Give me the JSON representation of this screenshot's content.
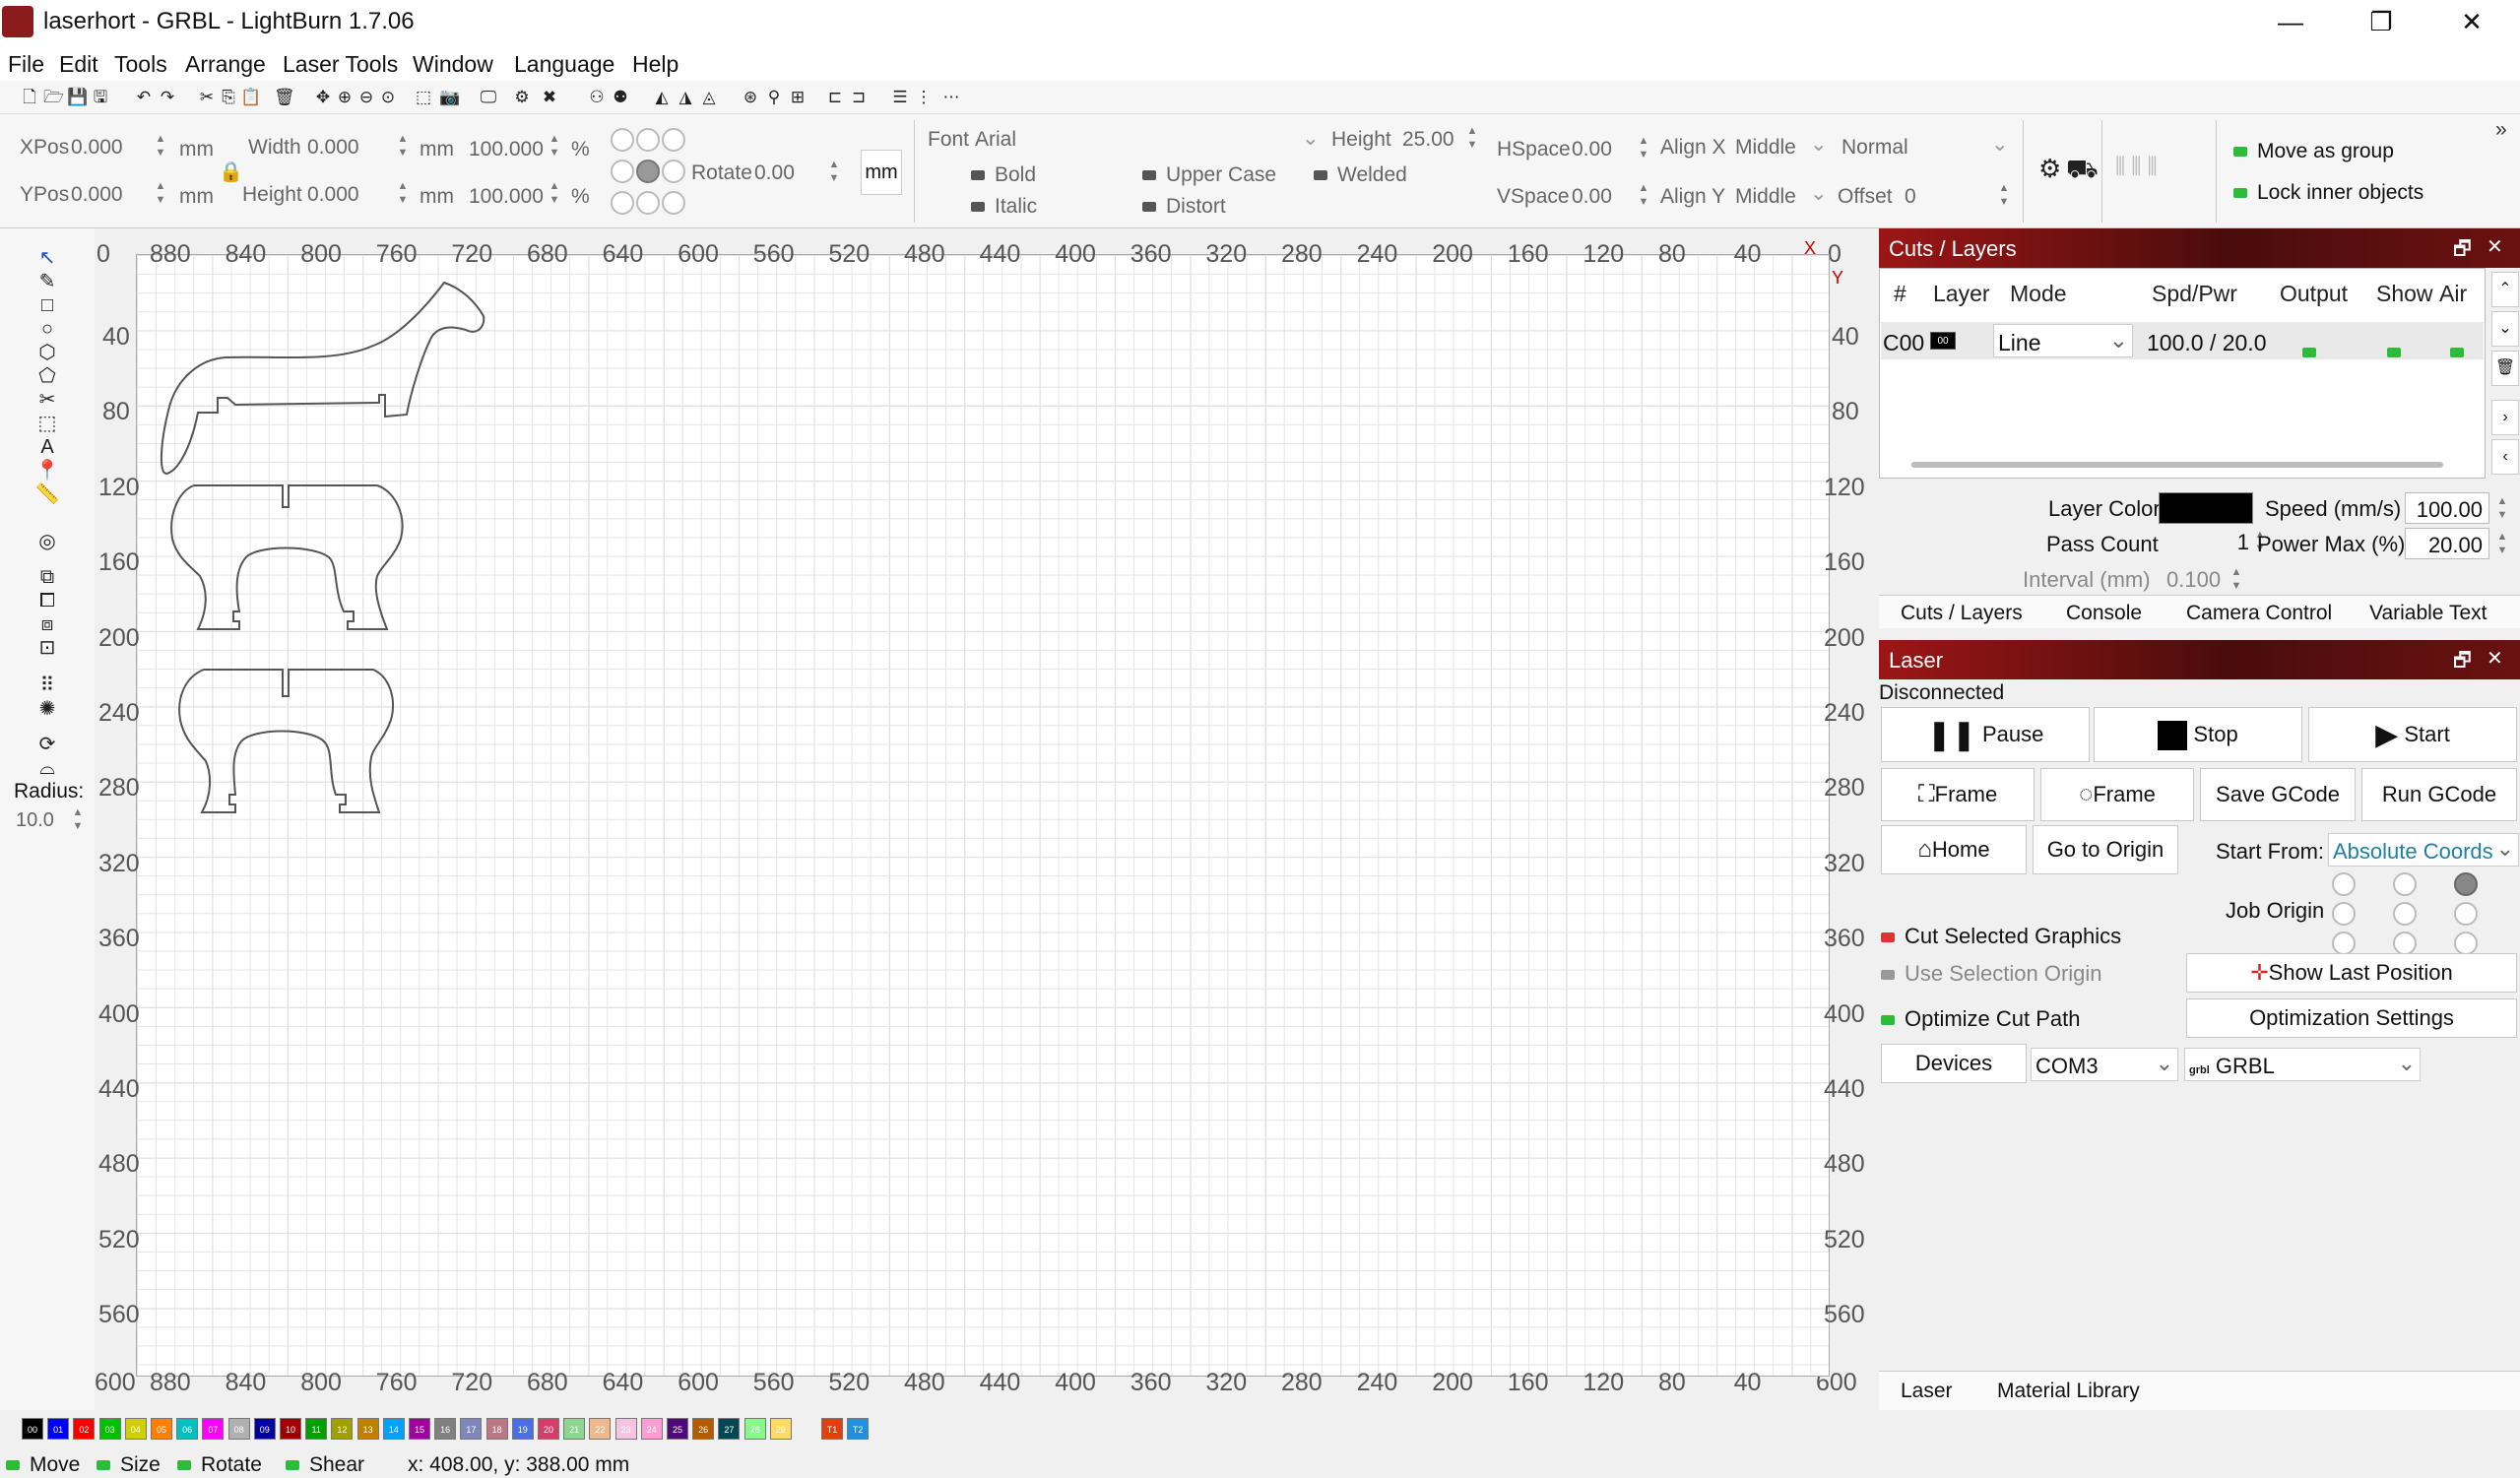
{
  "window": {
    "title": "laserhort - GRBL - LightBurn 1.7.06",
    "minimize": "—",
    "maximize": "❐",
    "close": "✕"
  },
  "menu": [
    "File",
    "Edit",
    "Tools",
    "Arrange",
    "Laser Tools",
    "Window",
    "Language",
    "Help"
  ],
  "props": {
    "xpos_label": "XPos",
    "xpos": "0.000",
    "ypos_label": "YPos",
    "ypos": "0.000",
    "unit": "mm",
    "width_label": "Width",
    "width": "0.000",
    "height_label": "Height",
    "height": "0.000",
    "scale_w": "100.000",
    "scale_h": "100.000",
    "pct": "%",
    "rotate_label": "Rotate",
    "rotate": "0.00",
    "units_btn": "mm",
    "font_label": "Font",
    "font": "Arial",
    "fheight_label": "Height",
    "fheight": "25.00",
    "hspace_label": "HSpace",
    "hspace": "0.00",
    "vspace_label": "VSpace",
    "vspace": "0.00",
    "alignx_label": "Align X",
    "alignx": "Middle",
    "aligny_label": "Align Y",
    "aligny": "Middle",
    "style": "Normal",
    "offset_label": "Offset",
    "offset": "0",
    "bold": "Bold",
    "italic": "Italic",
    "upper": "Upper Case",
    "distort": "Distort",
    "welded": "Welded",
    "move_group": "Move as group",
    "lock_inner": "Lock inner objects"
  },
  "left": {
    "radius_label": "Radius:",
    "radius": "10.0"
  },
  "ruler": {
    "top": [
      "880",
      "840",
      "800",
      "760",
      "720",
      "680",
      "640",
      "600",
      "560",
      "520",
      "480",
      "440",
      "400",
      "360",
      "320",
      "280",
      "240",
      "200",
      "160",
      "120",
      "80",
      "40"
    ],
    "side": [
      "40",
      "80",
      "120",
      "160",
      "200",
      "240",
      "280",
      "320",
      "360",
      "400",
      "440",
      "480",
      "520",
      "560"
    ],
    "corner_top_left": "0",
    "corner_top_right": "0",
    "corner_bottom": "600",
    "x": "X",
    "y": "Y"
  },
  "cuts": {
    "title": "Cuts / Layers",
    "headers": [
      "#",
      "Layer",
      "Mode",
      "Spd/Pwr",
      "Output",
      "Show",
      "Air"
    ],
    "row": {
      "num": "C00",
      "layer": "00",
      "mode": "Line",
      "spdpwr": "100.0 / 20.0"
    },
    "layer_color_label": "Layer Color",
    "layer_color": "#000000",
    "speed_label": "Speed (mm/s)",
    "speed": "100.00",
    "pass_label": "Pass Count",
    "pass": "1",
    "power_label": "Power Max (%)",
    "power": "20.00",
    "interval_label": "Interval (mm)",
    "interval": "0.100",
    "tabs": [
      "Cuts / Layers",
      "Console",
      "Camera Control",
      "Variable Text"
    ]
  },
  "laser": {
    "title": "Laser",
    "status": "Disconnected",
    "pause": "Pause",
    "stop": "Stop",
    "start": "Start",
    "frame1": "Frame",
    "frame2": "Frame",
    "save": "Save GCode",
    "run": "Run GCode",
    "home": "Home",
    "origin": "Go to Origin",
    "startfrom_label": "Start From:",
    "startfrom": "Absolute Coords",
    "joborigin": "Job Origin",
    "cut_sel": "Cut Selected Graphics",
    "use_sel": "Use Selection Origin",
    "optimize": "Optimize Cut Path",
    "show_last": "Show Last Position",
    "opt_settings": "Optimization Settings",
    "devices": "Devices",
    "port": "COM3",
    "device_type": "GRBL",
    "grbl_icon": "grbl",
    "tabs": [
      "Laser",
      "Material Library"
    ]
  },
  "palette": [
    {
      "n": "00",
      "c": "#000000"
    },
    {
      "n": "01",
      "c": "#0000ff"
    },
    {
      "n": "02",
      "c": "#ff0000"
    },
    {
      "n": "03",
      "c": "#00c000"
    },
    {
      "n": "04",
      "c": "#d0d000"
    },
    {
      "n": "05",
      "c": "#ff8000"
    },
    {
      "n": "06",
      "c": "#00c0c0"
    },
    {
      "n": "07",
      "c": "#ff00ff"
    },
    {
      "n": "08",
      "c": "#b0b0b0"
    },
    {
      "n": "09",
      "c": "#0000a0"
    },
    {
      "n": "10",
      "c": "#a00000"
    },
    {
      "n": "11",
      "c": "#00a000"
    },
    {
      "n": "12",
      "c": "#a0a000"
    },
    {
      "n": "13",
      "c": "#c08000"
    },
    {
      "n": "14",
      "c": "#00a0ff"
    },
    {
      "n": "15",
      "c": "#a000a0"
    },
    {
      "n": "16",
      "c": "#808080"
    },
    {
      "n": "17",
      "c": "#7d87b9"
    },
    {
      "n": "18",
      "c": "#bb7784"
    },
    {
      "n": "19",
      "c": "#4a6fe3"
    },
    {
      "n": "20",
      "c": "#d33f6a"
    },
    {
      "n": "21",
      "c": "#8cd78f"
    },
    {
      "n": "22",
      "c": "#f0b98d"
    },
    {
      "n": "23",
      "c": "#f6c4e1"
    },
    {
      "n": "24",
      "c": "#fa9ed4"
    },
    {
      "n": "25",
      "c": "#500a78"
    },
    {
      "n": "26",
      "c": "#b45a00"
    },
    {
      "n": "27",
      "c": "#004754"
    },
    {
      "n": "28",
      "c": "#86fa88"
    },
    {
      "n": "29",
      "c": "#ffdb66"
    },
    {
      "n": "T1",
      "c": "#e04010"
    },
    {
      "n": "T2",
      "c": "#2090e0"
    }
  ],
  "status": {
    "move": "Move",
    "size": "Size",
    "rotate": "Rotate",
    "shear": "Shear",
    "coords": "x: 408.00, y: 388.00 mm"
  }
}
